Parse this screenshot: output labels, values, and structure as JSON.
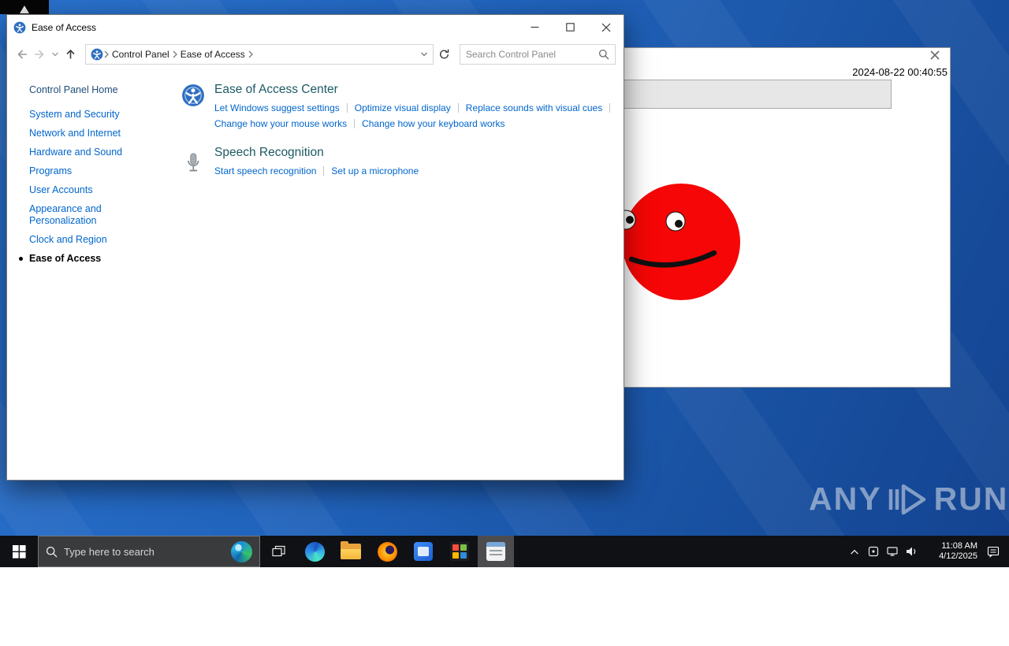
{
  "colors": {
    "desktop_blue": "#2164bd",
    "taskbar_bg": "#101114",
    "link_blue": "#0066cc",
    "section_heading": "#1d5a63",
    "sidebar_link": "#0066cc",
    "blob_red": "#f60606",
    "bar_gray": "#e7e7e7"
  },
  "cp_window": {
    "title": "Ease of Access",
    "breadcrumb": [
      "Control Panel",
      "Ease of Access"
    ],
    "search_placeholder": "Search Control Panel",
    "sidebar": {
      "home": "Control Panel Home",
      "items": [
        "System and Security",
        "Network and Internet",
        "Hardware and Sound",
        "Programs",
        "User Accounts",
        "Appearance and Personalization",
        "Clock and Region"
      ],
      "active_item": "Ease of Access"
    },
    "sections": [
      {
        "title": "Ease of Access Center",
        "row1": [
          "Let Windows suggest settings",
          "Optimize visual display",
          "Replace sounds with visual cues"
        ],
        "row2": [
          "Change how your mouse works",
          "Change how your keyboard works"
        ]
      },
      {
        "title": "Speech Recognition",
        "row1": [
          "Start speech recognition",
          "Set up a microphone"
        ],
        "row2": []
      }
    ]
  },
  "bg_window": {
    "timestamp": "2024-08-22 00:40:55"
  },
  "watermark": {
    "any": "ANY",
    "run": "RUN"
  },
  "taskbar": {
    "search_placeholder": "Type here to search",
    "time": "11:08 AM",
    "date": "4/12/2025"
  }
}
